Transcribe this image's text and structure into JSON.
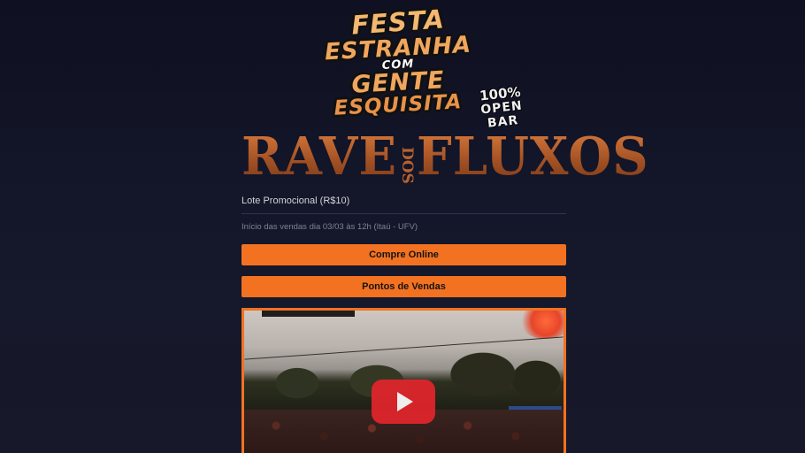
{
  "logo": {
    "line1": "FESTA",
    "line2": "ESTRANHA",
    "line3": "COM",
    "line4": "GENTE",
    "line5": "ESQUISITA",
    "open_bar_pct": "100%",
    "open_bar_text": "OPEN BAR"
  },
  "event": {
    "title_left": "RAVE",
    "title_middle": "DOS",
    "title_right": "FLUXOS"
  },
  "ticket": {
    "lote": "Lote Promocional (R$10)",
    "info": "Início das vendas dia 03/03 às 12h (Itaú - UFV)"
  },
  "buttons": {
    "compre": "Compre Online",
    "pontos": "Pontos de Vendas"
  },
  "video": {
    "play_icon": "play-icon",
    "accent_color": "#f37221",
    "play_color": "#e3252c"
  }
}
